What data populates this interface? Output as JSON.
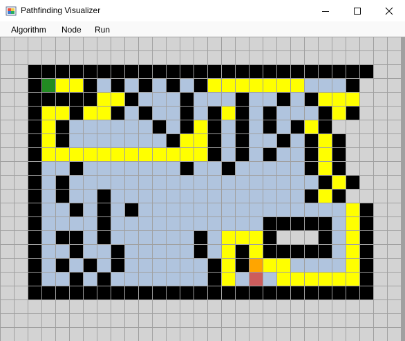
{
  "window": {
    "title": "Pathfinding Visualizer",
    "minimize_icon": "minimize-icon",
    "maximize_icon": "maximize-icon",
    "close_icon": "close-icon"
  },
  "menu": {
    "items": [
      "Algorithm",
      "Node",
      "Run"
    ]
  },
  "legend_colors": {
    "wall": "#000000",
    "empty": "#d3d3d3",
    "start": "#228b22",
    "end": "#cd5c5c",
    "path": "#ffff00",
    "visited": "#b0c4de",
    "current": "#ffa500",
    "grid_line": "#a0a0a0"
  },
  "grid": {
    "cols": 29,
    "rows": 22,
    "cells": [
      ".............................",
      ".............................",
      "..#########################..",
      "..#SYY#v#v#v#v#YYYYYYYvvv#..",
      "..#####YY#vvv#vvv#vv#v#YYY.",
      "..#YY#YY#v#vv#v#Y#v#vvv#Y#..",
      "..#Y#vvvvvv#v#Y#v#v#v#Y#..",
      "..#Y#vvvvvvv#YY#v#vv#v#Y#..",
      "..#YYYYYYYYYYYY#v#v#vv#Y#..",
      "..#vv#vvvvvvv#vv#vvvvv#Y#..",
      "..#v#vvvvvvvvvvvvvvvvvv#Y#..",
      "..#v#vv#vvvvvvvvvvvvvv#Y#..",
      "..#vv#v#v#vvvvvvvvvvvvvvvY#..",
      "..#vvvv#vvvvvvvvvvv#####vY#..",
      "..#v##v#vvvvvv#vYYY#...#vY#..",
      "..#vv#vv#vvvvv#vY#Y#####vY#..",
      "..#v#v#v#vvvvvv#Y#OYYvvvvY#..",
      "..#vv#v#vvvvvvv#YvEvYYYYYY#..",
      "..#########################..",
      ".............................",
      ".............................",
      "............................."
    ]
  }
}
